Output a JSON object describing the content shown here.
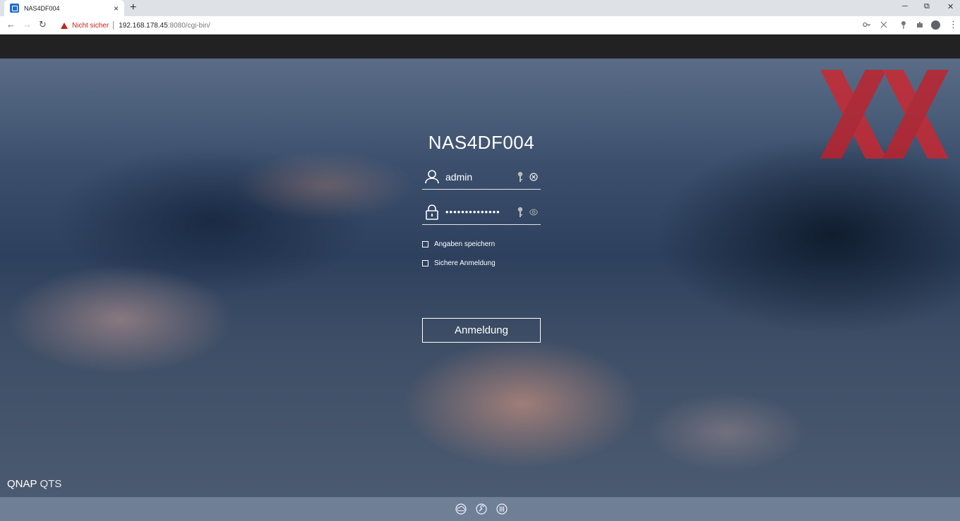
{
  "browser": {
    "tab_title": "NAS4DF004",
    "tab_close": "×",
    "new_tab": "+",
    "window": {
      "minimize": "─",
      "restore": "⧉",
      "close": "✕"
    },
    "nav": {
      "back": "←",
      "forward": "→",
      "reload": "↻"
    },
    "security_label": "Nicht sicher",
    "url_host": "192.168.178.45",
    "url_rest": ":8080/cgi-bin/",
    "menu": "⋮"
  },
  "login": {
    "hostname": "NAS4DF004",
    "username": "admin",
    "password_mask": "••••••••••••••",
    "remember_label": "Angaben speichern",
    "secure_label": "Sichere Anmeldung",
    "submit_label": "Anmeldung"
  },
  "brand": {
    "name": "QNAP",
    "product": "QTS"
  },
  "icons": {
    "user": "user-icon",
    "lock": "lock-icon",
    "key": "key-icon",
    "clear": "clear-icon",
    "eye": "eye-icon",
    "footer": [
      "cloud-icon",
      "tool-icon",
      "library-icon"
    ]
  },
  "colors": {
    "topbar": "#222222",
    "footer": "#6f7f95",
    "insecure": "#c5221f",
    "watermark": "#d4242c"
  }
}
